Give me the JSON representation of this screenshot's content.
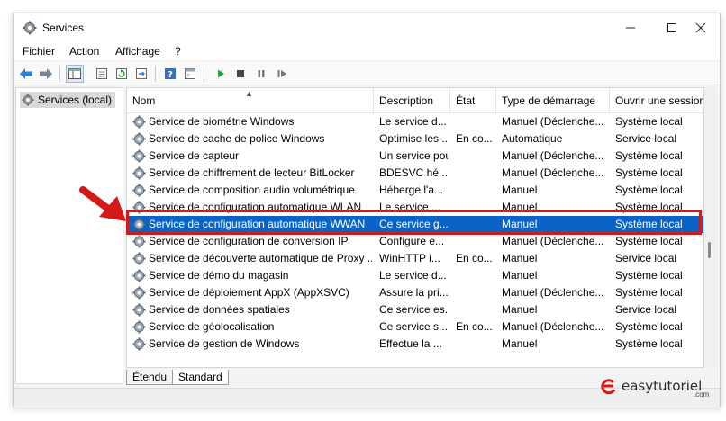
{
  "window": {
    "title": "Services",
    "minimize_icon": "minimize-icon",
    "maximize_icon": "maximize-icon",
    "close_icon": "close-icon"
  },
  "menu": [
    "Fichier",
    "Action",
    "Affichage",
    "?"
  ],
  "toolbar": {
    "icons": [
      "back-arrow-icon",
      "forward-arrow-icon",
      "show-tree-icon",
      "properties-icon",
      "refresh-icon",
      "export-list-icon",
      "help-icon",
      "console-view-icon",
      "start-service-icon",
      "stop-service-icon",
      "pause-service-icon",
      "restart-service-icon"
    ]
  },
  "tree": {
    "item_label": "Services (local)"
  },
  "columns": [
    "Nom",
    "Description",
    "État",
    "Type de démarrage",
    "Ouvrir une session"
  ],
  "rows": [
    {
      "name": "Service de biométrie Windows",
      "desc": "Le service d...",
      "state": "",
      "startup": "Manuel (Déclenche...",
      "logon": "Système local"
    },
    {
      "name": "Service de cache de police Windows",
      "desc": "Optimise les ...",
      "state": "En co...",
      "startup": "Automatique",
      "logon": "Service local"
    },
    {
      "name": "Service de capteur",
      "desc": "Un service pou...",
      "state": "",
      "startup": "Manuel (Déclenche...",
      "logon": "Système local"
    },
    {
      "name": "Service de chiffrement de lecteur BitLocker",
      "desc": "BDESVC hé...",
      "state": "",
      "startup": "Manuel (Déclenche...",
      "logon": "Système local"
    },
    {
      "name": "Service de composition audio volumétrique",
      "desc": "Héberge l'a...",
      "state": "",
      "startup": "Manuel",
      "logon": "Système local"
    },
    {
      "name": "Service de configuration automatique WLAN",
      "desc": "Le service ...",
      "state": "",
      "startup": "Manuel",
      "logon": "Système local"
    },
    {
      "name": "Service de configuration automatique WWAN",
      "desc": "Ce service g...",
      "state": "",
      "startup": "Manuel",
      "logon": "Système local",
      "selected": true
    },
    {
      "name": "Service de configuration de conversion IP",
      "desc": "Configure e...",
      "state": "",
      "startup": "Manuel (Déclenche...",
      "logon": "Système local"
    },
    {
      "name": "Service de découverte automatique de Proxy ...",
      "desc": "WinHTTP i...",
      "state": "En co...",
      "startup": "Manuel",
      "logon": "Service local"
    },
    {
      "name": "Service de démo du magasin",
      "desc": "Le service d...",
      "state": "",
      "startup": "Manuel",
      "logon": "Système local"
    },
    {
      "name": "Service de déploiement AppX (AppXSVC)",
      "desc": "Assure la pri...",
      "state": "",
      "startup": "Manuel (Déclenche...",
      "logon": "Système local"
    },
    {
      "name": "Service de données spatiales",
      "desc": "Ce service es...",
      "state": "",
      "startup": "Manuel",
      "logon": "Service local"
    },
    {
      "name": "Service de géolocalisation",
      "desc": "Ce service s...",
      "state": "En co...",
      "startup": "Manuel (Déclenche...",
      "logon": "Système local"
    },
    {
      "name": "Service de gestion de Windows",
      "desc": "Effectue la ...",
      "state": "",
      "startup": "Manuel",
      "logon": "Système local"
    }
  ],
  "tabs": [
    "Étendu",
    "Standard"
  ],
  "watermark": {
    "name": "easytutoriel",
    "suffix": ".com"
  },
  "colors": {
    "selection": "#0a64c8",
    "highlight_border": "#d41919",
    "arrow": "#d41919"
  }
}
